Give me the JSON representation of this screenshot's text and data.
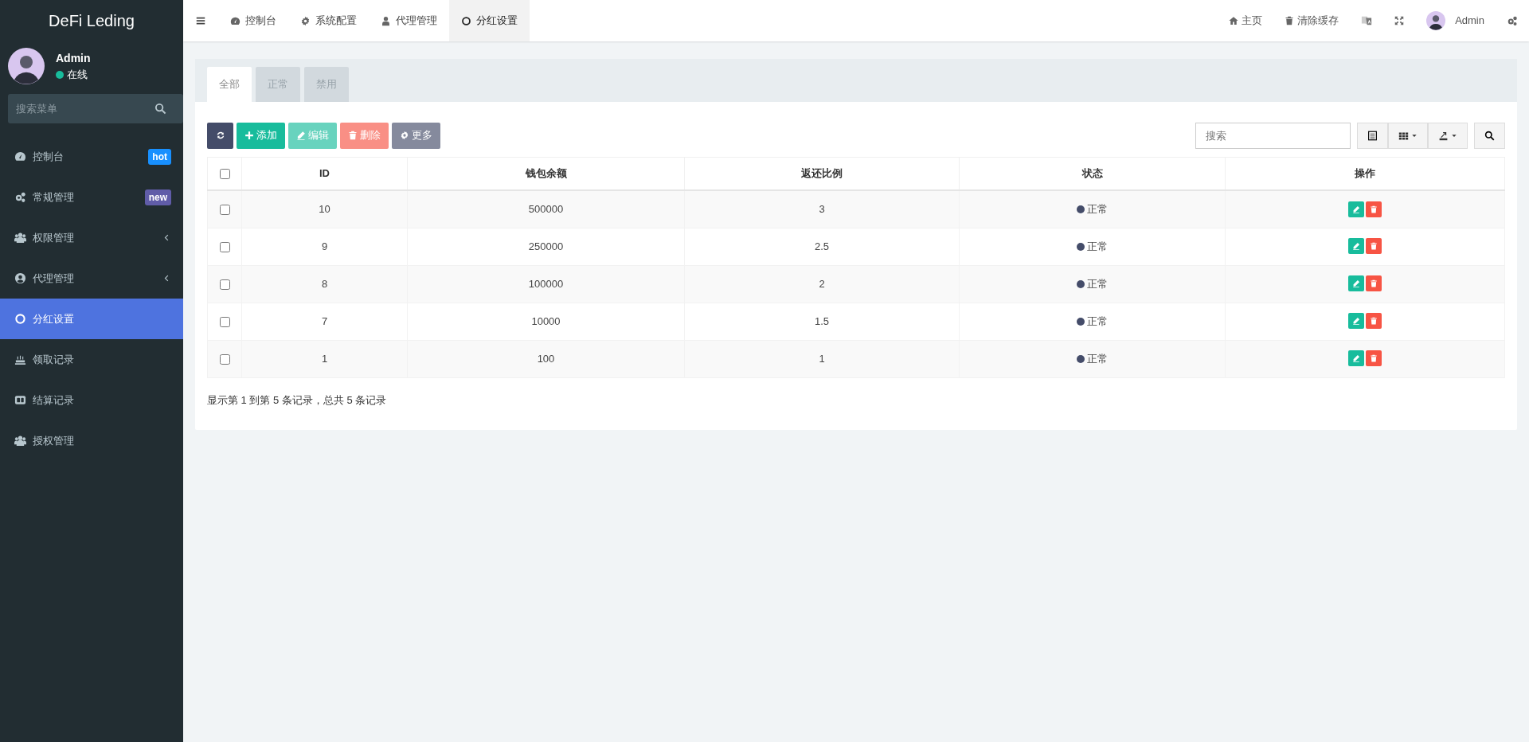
{
  "sidebar": {
    "logo": "DeFi Leding",
    "user": {
      "name": "Admin",
      "status": "在线"
    },
    "search": {
      "placeholder": "搜索菜单"
    },
    "items": [
      {
        "label": "控制台",
        "badge": {
          "text": "hot",
          "color": "#1890ff"
        },
        "expandable": false,
        "selected": false
      },
      {
        "label": "常规管理",
        "badge": {
          "text": "new",
          "color": "#605ca8"
        },
        "expandable": false,
        "selected": false
      },
      {
        "label": "权限管理",
        "expandable": true,
        "selected": false
      },
      {
        "label": "代理管理",
        "expandable": true,
        "selected": false
      },
      {
        "label": "分红设置",
        "expandable": false,
        "selected": true
      },
      {
        "label": "领取记录",
        "expandable": false,
        "selected": false
      },
      {
        "label": "结算记录",
        "expandable": false,
        "selected": false
      },
      {
        "label": "授权管理",
        "expandable": false,
        "selected": false
      }
    ]
  },
  "topbar": {
    "tabs": [
      {
        "label": "控制台",
        "selected": false
      },
      {
        "label": "系统配置",
        "selected": false
      },
      {
        "label": "代理管理",
        "selected": false
      },
      {
        "label": "分红设置",
        "selected": true
      }
    ],
    "links": [
      "主页",
      "清除缓存"
    ],
    "user": "Admin"
  },
  "content": {
    "tabs": [
      {
        "label": "全部",
        "selected": true
      },
      {
        "label": "正常",
        "selected": false
      },
      {
        "label": "禁用",
        "selected": false
      }
    ],
    "toolbar": [
      {
        "kind": "refresh",
        "disabled": false
      },
      {
        "kind": "add",
        "label": "添加",
        "disabled": false
      },
      {
        "kind": "edit",
        "label": "编辑",
        "disabled": true
      },
      {
        "kind": "delete",
        "label": "删除",
        "disabled": true
      },
      {
        "kind": "more",
        "label": "更多",
        "disabled": true
      }
    ],
    "search": {
      "placeholder": "搜索"
    },
    "table": {
      "select_all": {
        "checked": false
      },
      "columns": [
        "ID",
        "钱包余额",
        "返还比例",
        "状态",
        "操作"
      ],
      "rows": [
        {
          "checked": false,
          "id": "10",
          "balance": "500000",
          "ratio": "3",
          "status": "正常"
        },
        {
          "checked": false,
          "id": "9",
          "balance": "250000",
          "ratio": "2.5",
          "status": "正常"
        },
        {
          "checked": false,
          "id": "8",
          "balance": "100000",
          "ratio": "2",
          "status": "正常"
        },
        {
          "checked": false,
          "id": "7",
          "balance": "10000",
          "ratio": "1.5",
          "status": "正常"
        },
        {
          "checked": false,
          "id": "1",
          "balance": "100",
          "ratio": "1",
          "status": "正常"
        }
      ]
    },
    "footer": "显示第 1 到第 5 条记录，总共 5 条记录"
  }
}
